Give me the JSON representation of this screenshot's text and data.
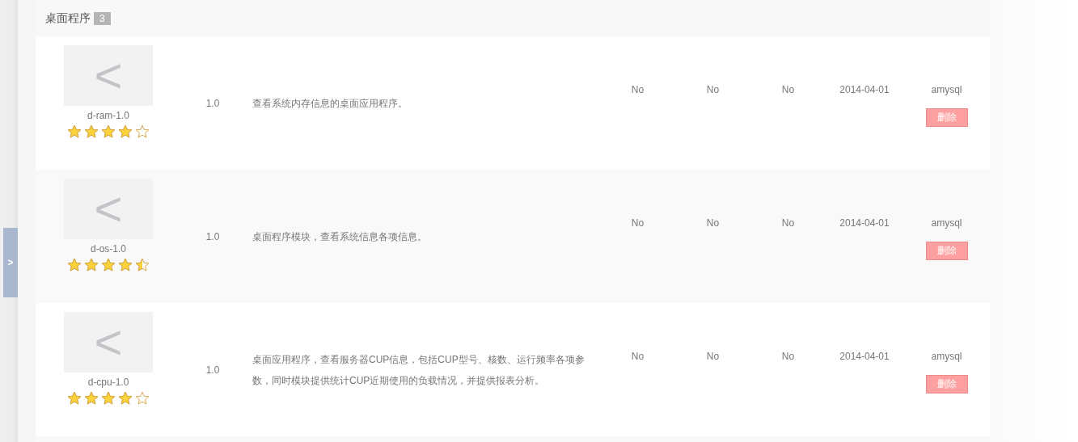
{
  "section": {
    "title": "桌面程序",
    "count": "3"
  },
  "sidebar_toggle": {
    "label": ">"
  },
  "rows": [
    {
      "icon_glyph": "<",
      "name": "d-ram-1.0",
      "stars": 4,
      "version": "1.0",
      "description": "查看系统内存信息的桌面应用程序。",
      "column_4": "No",
      "column_5": "No",
      "column_6": "No",
      "date": "2014-04-01",
      "author": "amysql",
      "action": "删除"
    },
    {
      "icon_glyph": "<",
      "name": "d-os-1.0",
      "stars": 4.5,
      "version": "1.0",
      "description": "桌面程序模块，查看系统信息各项信息。",
      "column_4": "No",
      "column_5": "No",
      "column_6": "No",
      "date": "2014-04-01",
      "author": "amysql",
      "action": "删除"
    },
    {
      "icon_glyph": "<",
      "name": "d-cpu-1.0",
      "stars": 4,
      "version": "1.0",
      "description": "桌面应用程序，查看服务器CUP信息，包括CUP型号、核数、运行频率各项参数，同时模块提供统计CUP近期使用的负载情况，并提供报表分析。",
      "column_4": "No",
      "column_5": "No",
      "column_6": "No",
      "date": "2014-04-01",
      "author": "amysql",
      "action": "删除"
    }
  ]
}
